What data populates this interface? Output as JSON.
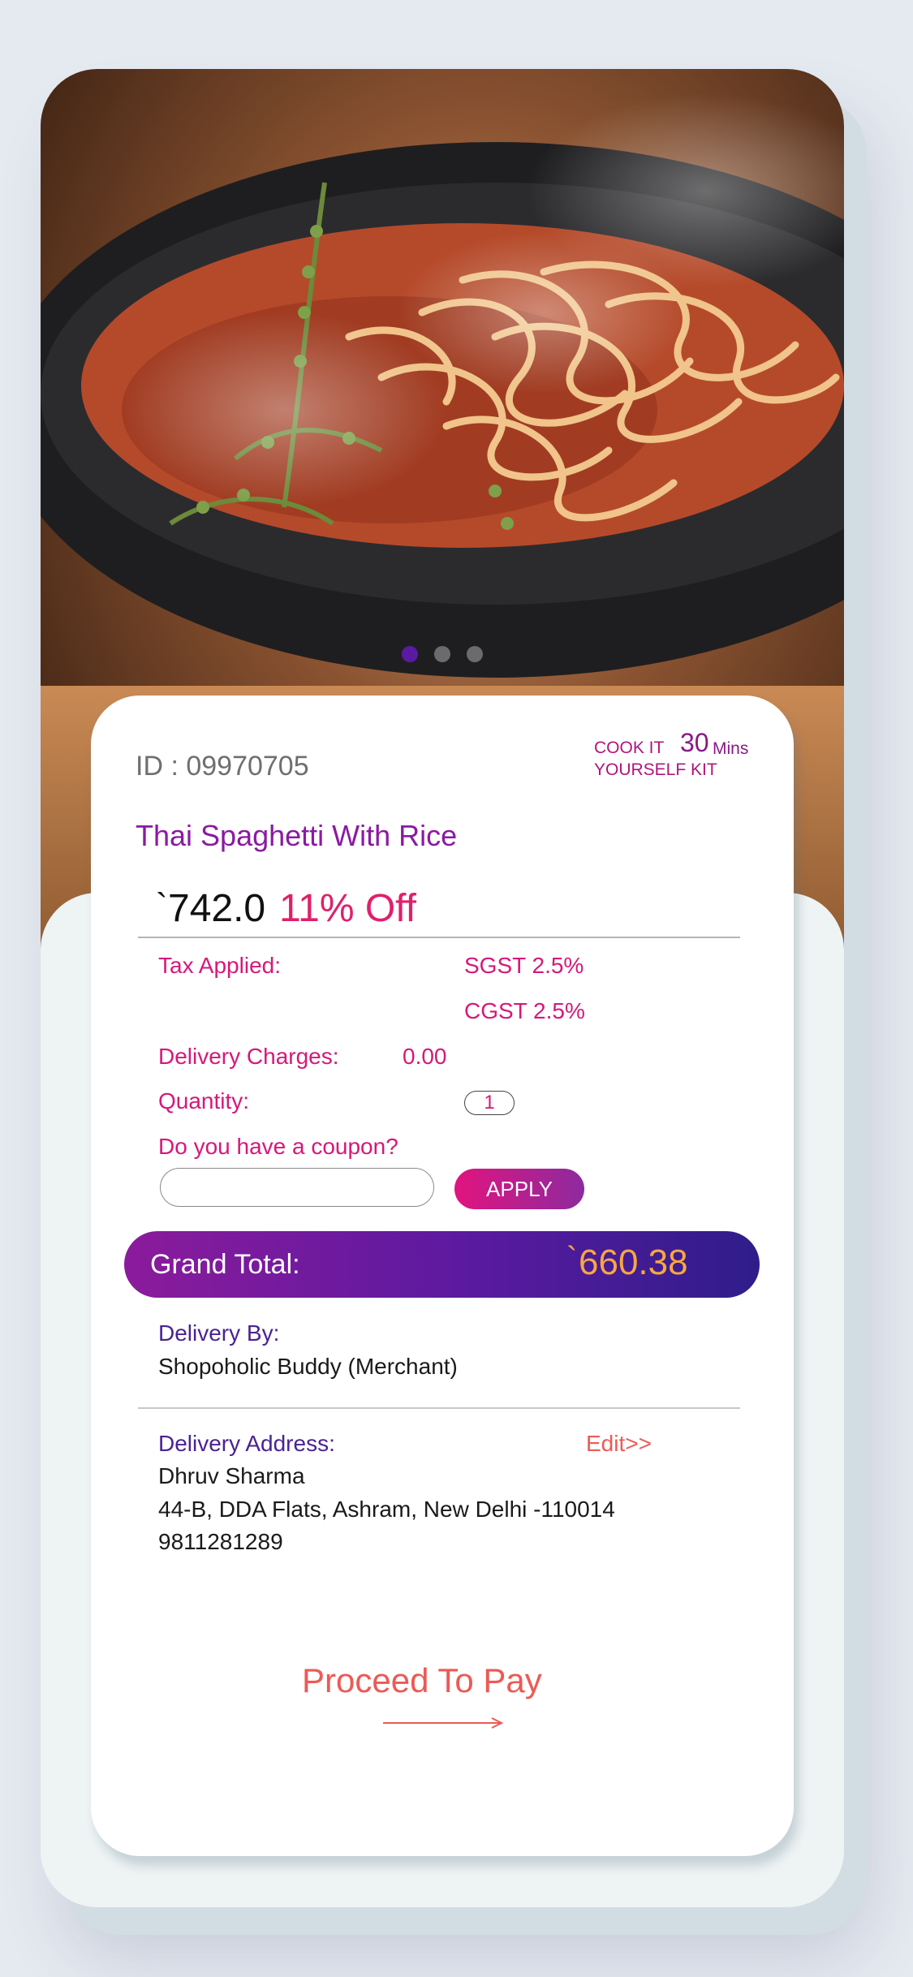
{
  "carousel": {
    "count": 3,
    "active_index": 0,
    "colors": {
      "active": "#5a1aa4",
      "inactive": "#6b6b6b"
    }
  },
  "product": {
    "id_text": "ID : 09970705",
    "kit_line1": "COOK IT",
    "kit_line2": "YOURSELF KIT",
    "cook_time": "30",
    "cook_time_unit": "Mins",
    "title": "Thai Spaghetti With Rice",
    "currency_symbol": "`",
    "price": "742.0",
    "discount": "11% Off"
  },
  "charges": {
    "tax_label": "Tax Applied:",
    "sgst": "SGST 2.5%",
    "cgst": "CGST 2.5%",
    "delivery_label": "Delivery Charges:",
    "delivery_value": "0.00",
    "quantity_label": "Quantity:",
    "quantity_value": "1"
  },
  "coupon": {
    "question": "Do you have a coupon?",
    "input_value": "",
    "apply_label": "APPLY"
  },
  "grand_total": {
    "label": "Grand Total:",
    "currency_symbol": "`",
    "value": "660.38"
  },
  "delivery": {
    "by_label": "Delivery By:",
    "merchant": "Shopoholic Buddy (Merchant)",
    "address_label": "Delivery Address:",
    "edit_label": "Edit>>",
    "name": "Dhruv Sharma",
    "address": "44-B, DDA Flats, Ashram, New Delhi -110014",
    "phone": "9811281289"
  },
  "proceed_label": "Proceed To Pay",
  "colors": {
    "accent_pink": "#d6187a",
    "accent_purple": "#8a1aa2",
    "grand_total_value": "#f6a742",
    "link_coral": "#ec5a55"
  }
}
